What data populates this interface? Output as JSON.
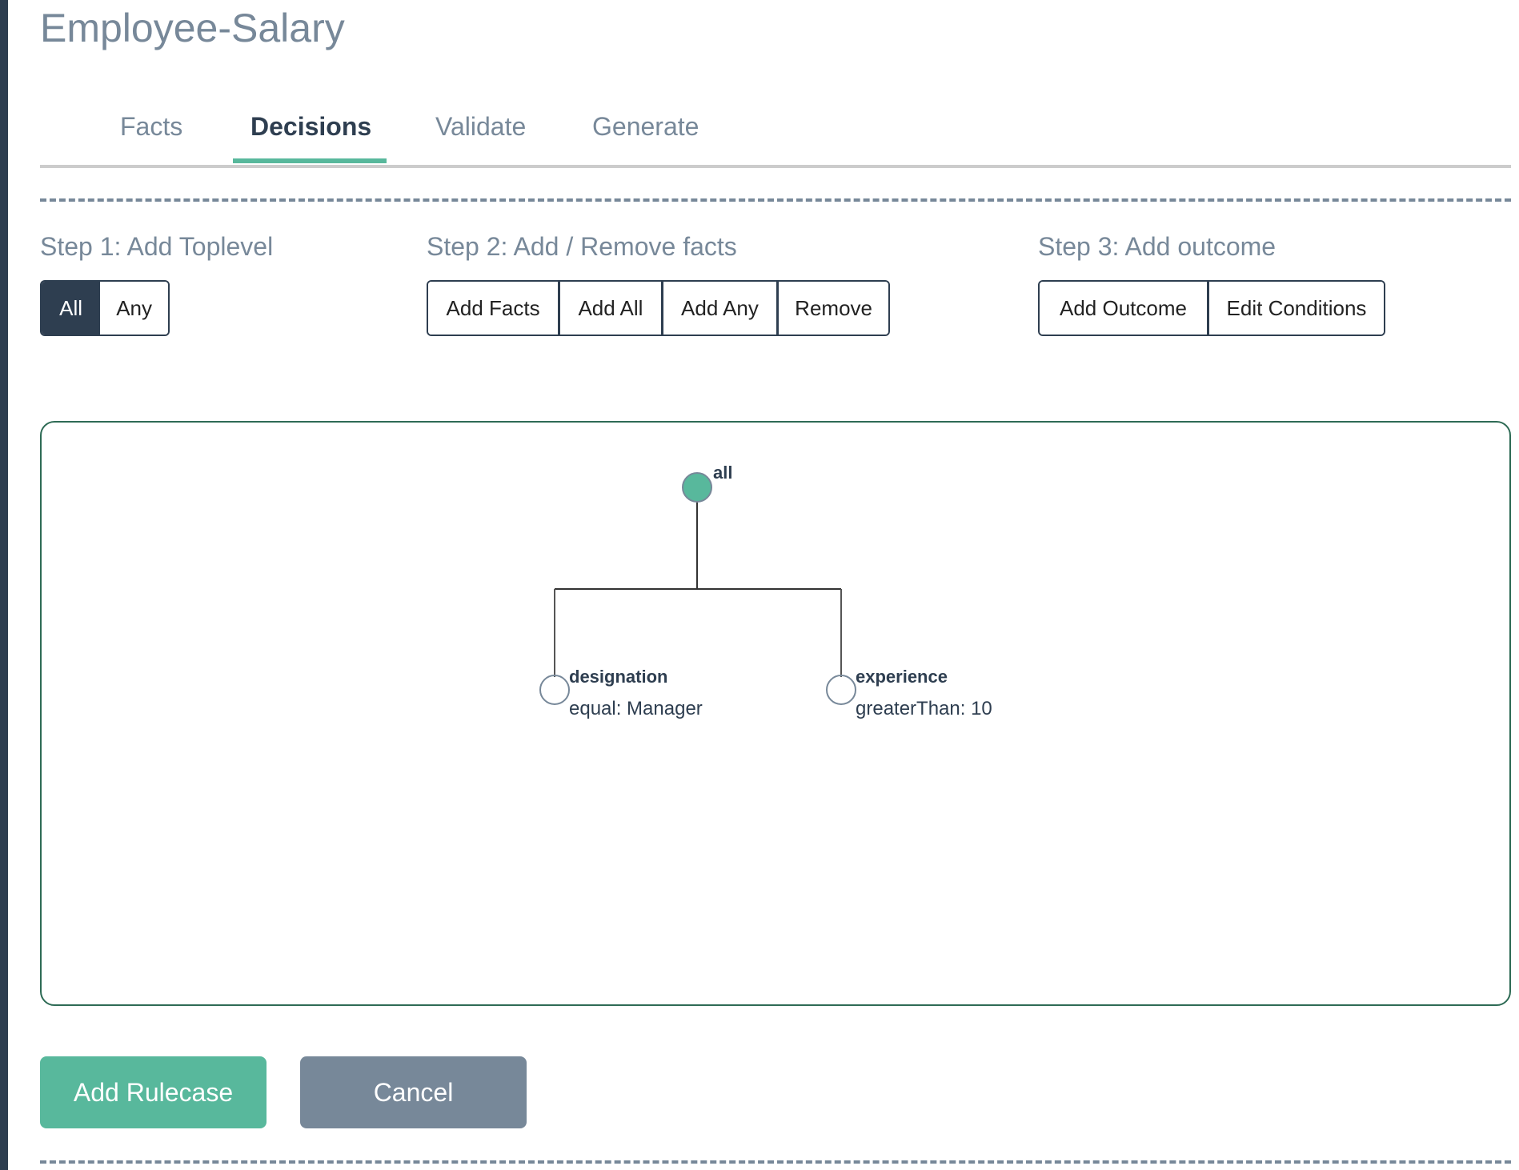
{
  "page": {
    "title": "Employee-Salary"
  },
  "tabs": [
    {
      "label": "Facts",
      "active": false
    },
    {
      "label": "Decisions",
      "active": true
    },
    {
      "label": "Validate",
      "active": false
    },
    {
      "label": "Generate",
      "active": false
    }
  ],
  "steps": {
    "step1": {
      "label": "Step 1: Add Toplevel",
      "buttons": [
        {
          "label": "All",
          "selected": true
        },
        {
          "label": "Any",
          "selected": false
        }
      ]
    },
    "step2": {
      "label": "Step 2: Add / Remove facts",
      "buttons": [
        {
          "label": "Add Facts"
        },
        {
          "label": "Add All"
        },
        {
          "label": "Add Any"
        },
        {
          "label": "Remove"
        }
      ]
    },
    "step3": {
      "label": "Step 3: Add outcome",
      "buttons": [
        {
          "label": "Add Outcome"
        },
        {
          "label": "Edit Conditions"
        }
      ]
    }
  },
  "tree": {
    "root": {
      "name": "all",
      "type": "toplevel"
    },
    "children": [
      {
        "name": "designation",
        "condition": "equal: Manager"
      },
      {
        "name": "experience",
        "condition": "greaterThan: 10"
      }
    ]
  },
  "actions": {
    "add_rulecase": "Add Rulecase",
    "cancel": "Cancel"
  },
  "colors": {
    "accent": "#58b89c",
    "dark": "#2e3e50",
    "muted": "#778899",
    "canvas_border": "#2e6b55"
  }
}
